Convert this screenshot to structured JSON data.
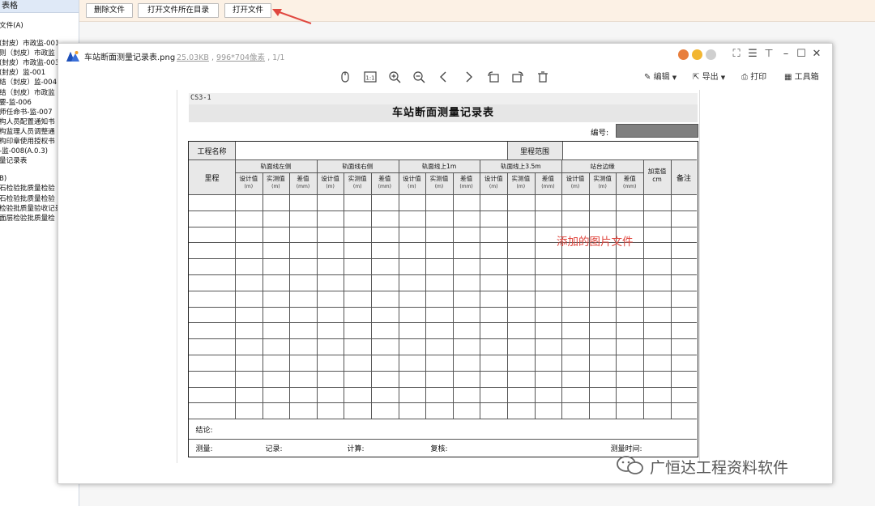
{
  "left_tree": {
    "header": "表格",
    "items": [
      {
        "label": "文件(A)",
        "gap": true
      },
      {
        "label": "(封皮）市政监-001",
        "gap": true
      },
      {
        "label": "则（封皮）市政监"
      },
      {
        "label": "(封皮）市政监-003"
      },
      {
        "label": "(封皮）监-001"
      },
      {
        "label": "结（封皮）监-004"
      },
      {
        "label": "结（封皮）市政监"
      },
      {
        "label": "要-监-006"
      },
      {
        "label": "师任命书-监-007"
      },
      {
        "label": "构人员配置通知书"
      },
      {
        "label": "构监理人员调整通"
      },
      {
        "label": "构印章使用授权书"
      },
      {
        "label": "-监-008(A.0.3)"
      },
      {
        "label": "量记录表"
      },
      {
        "label": "B)",
        "gap": true
      },
      {
        "label": "石检验批质量检验"
      },
      {
        "label": "石检验批质量检验"
      },
      {
        "label": "检验批质量验收记录"
      },
      {
        "label": "面层检验批质量检"
      }
    ]
  },
  "topbar": {
    "delete_file": "删除文件",
    "open_folder": "打开文件所在目录",
    "open_file": "打开文件"
  },
  "viewer": {
    "file_name": "车站断面测量记录表.png",
    "file_size": "25.03KB",
    "dimensions": "996*704像素",
    "page_count": "1/1",
    "toolbar_right": {
      "edit": "编辑",
      "export": "导出",
      "print": "打印",
      "toolbox": "工具箱"
    },
    "overlay_label": "添加的图片文件"
  },
  "document": {
    "code": "CS3-1",
    "title": "车站断面测量记录表",
    "number_label": "编号:",
    "project_name": "工程名称",
    "mileage_range": "里程范围",
    "mileage": "里程",
    "groups": [
      "轨面线左侧",
      "轨面线右侧",
      "轨面线上1m",
      "轨面线上3.5m",
      "站台边缘"
    ],
    "subcols": [
      "设计值",
      "实测值",
      "差值"
    ],
    "subunits": [
      "(m)",
      "(m)",
      "(mm)"
    ],
    "widen": "加宽值",
    "widen_unit": "cm",
    "remark": "备注",
    "conclusion": "结论:",
    "footer": {
      "measure": "测量:",
      "record": "记录:",
      "calc": "计算:",
      "review": "复核:",
      "measure_time": "测量时间:"
    }
  },
  "watermark": "广恒达工程资料软件",
  "colors": {
    "topbar_bg": "#fcf1e5",
    "overlay_red": "#e0473f",
    "arrow_red": "#e0473f",
    "number_box": "#7f7f7f"
  }
}
